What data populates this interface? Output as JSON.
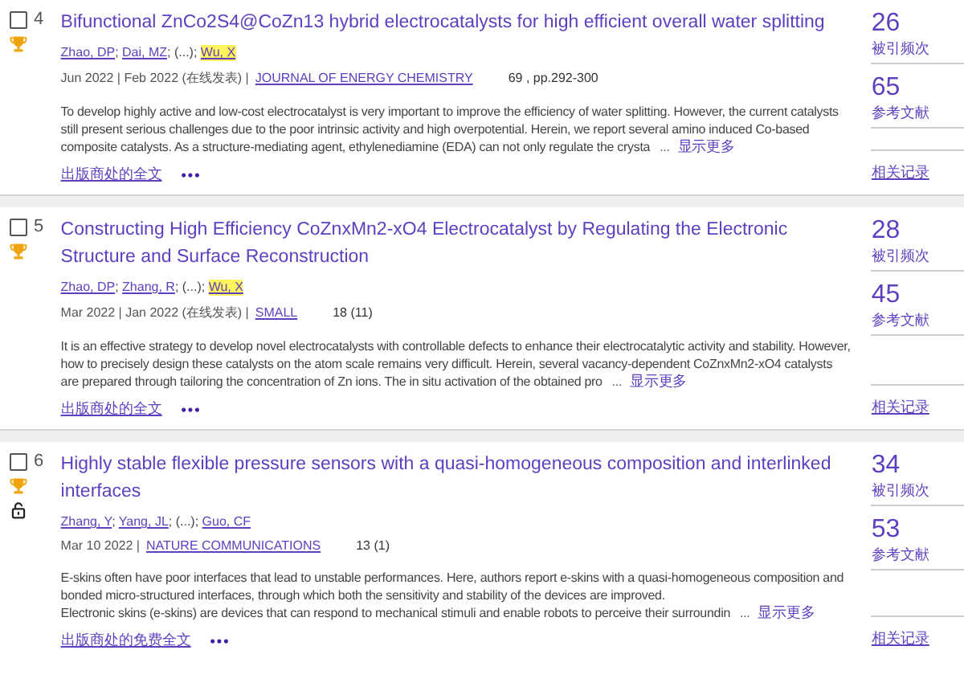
{
  "records": [
    {
      "number": "4",
      "selected": false,
      "title": "Bifunctional ZnCo2S4@CoZn13 hybrid electrocatalysts for high efficient overall water splitting",
      "badges": [
        {
          "kind": "trophy"
        }
      ],
      "authors": [
        {
          "kind": "link",
          "text": "Zhao, DP",
          "highlighted": false
        },
        {
          "kind": "text",
          "text": ";"
        },
        {
          "kind": "link",
          "text": "Dai, MZ",
          "highlighted": false
        },
        {
          "kind": "text",
          "text": "; (...);"
        },
        {
          "kind": "link",
          "text": "Wu, X",
          "highlighted": true
        }
      ],
      "date": "Jun 2022 | Feb 2022 (在线发表) |",
      "journal": "JOURNAL OF ENERGY CHEMISTRY",
      "volume": "69 , pp.292-300",
      "abstract": [
        "To develop highly active and low-cost electrocatalyst is very important to improve the efficiency of water splitting. However, the current catalysts still present serious challenges due to the poor intrinsic activity and high overpotential. Herein, we report several amino induced Co-based composite catalysts. As a structure-mediating agent, ethylenediamine (EDA) can not only regulate the crysta"
      ],
      "ellipsis": "...",
      "show_more": "显示更多",
      "full_text": "出版商处的全文",
      "more_options": "•••",
      "citations": "26",
      "citations_label": "被引频次",
      "references": "65",
      "references_label": "参考文献",
      "related": "相关记录"
    },
    {
      "number": "5",
      "selected": false,
      "title": "Constructing High Efficiency CoZnxMn2-xO4 Electrocatalyst by Regulating the Electronic Structure and Surface Reconstruction",
      "badges": [
        {
          "kind": "trophy"
        }
      ],
      "authors": [
        {
          "kind": "link",
          "text": "Zhao, DP",
          "highlighted": false
        },
        {
          "kind": "text",
          "text": ";"
        },
        {
          "kind": "link",
          "text": "Zhang, R",
          "highlighted": false
        },
        {
          "kind": "text",
          "text": "; (...);"
        },
        {
          "kind": "link",
          "text": "Wu, X",
          "highlighted": true
        }
      ],
      "date": "Mar 2022 | Jan 2022 (在线发表) |",
      "journal": "SMALL",
      "volume": "18 (11)",
      "abstract": [
        "It is an effective strategy to develop novel electrocatalysts with controllable defects to enhance their electrocatalytic activity and stability. However, how to precisely design these catalysts on the atom scale remains very difficult. Herein, several vacancy-dependent CoZnxMn2-xO4 catalysts are prepared through tailoring the concentration of Zn ions. The in situ activation of the obtained pro"
      ],
      "ellipsis": "...",
      "show_more": "显示更多",
      "full_text": "出版商处的全文",
      "more_options": "•••",
      "citations": "28",
      "citations_label": "被引频次",
      "references": "45",
      "references_label": "参考文献",
      "related": "相关记录"
    },
    {
      "number": "6",
      "selected": false,
      "title": "Highly stable flexible pressure sensors with a quasi-homogeneous composition and interlinked interfaces",
      "badges": [
        {
          "kind": "trophy"
        },
        {
          "kind": "open-access"
        }
      ],
      "authors": [
        {
          "kind": "link",
          "text": "Zhang, Y",
          "highlighted": false
        },
        {
          "kind": "text",
          "text": ";"
        },
        {
          "kind": "link",
          "text": "Yang, JL",
          "highlighted": false
        },
        {
          "kind": "text",
          "text": "; (...);"
        },
        {
          "kind": "link",
          "text": "Guo, CF",
          "highlighted": false
        }
      ],
      "date": "Mar 10 2022 |",
      "journal": "NATURE COMMUNICATIONS",
      "volume": "13 (1)",
      "abstract": [
        "E-skins often have poor interfaces that lead to unstable performances. Here, authors report e-skins with a quasi-homogeneous composition and bonded micro-structured interfaces, through which both the sensitivity and stability of the devices are improved.",
        "Electronic skins (e-skins) are devices that can respond to mechanical stimuli and enable robots to perceive their surroundin"
      ],
      "ellipsis": "...",
      "show_more": "显示更多",
      "full_text": "出版商处的免费全文",
      "more_options": "•••",
      "citations": "34",
      "citations_label": "被引频次",
      "references": "53",
      "references_label": "参考文献",
      "related": "相关记录"
    }
  ]
}
